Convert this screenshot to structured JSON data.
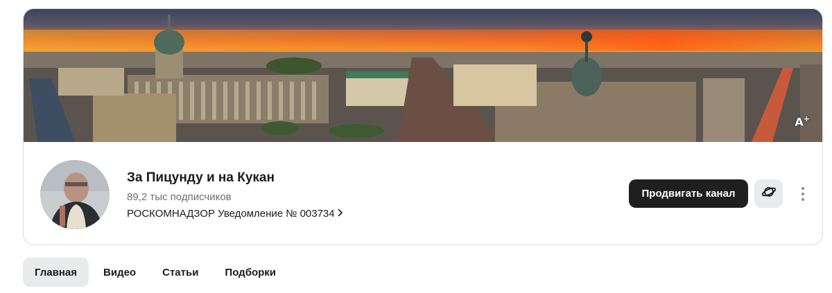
{
  "channel": {
    "name": "За Пицунду и на Кукан",
    "subscribers": "89,2 тыс подписчиков",
    "notice": "РОСКОМНАДЗОР Уведомление № 003734"
  },
  "banner": {
    "font_size_label": "A",
    "font_size_sup": "+"
  },
  "actions": {
    "promote_label": "Продвигать канал",
    "planet_icon": "planet-icon",
    "more_icon": "more-vertical-icon"
  },
  "tabs": [
    {
      "label": "Главная",
      "active": true
    },
    {
      "label": "Видео",
      "active": false
    },
    {
      "label": "Статьи",
      "active": false
    },
    {
      "label": "Подборки",
      "active": false
    }
  ],
  "colors": {
    "button_dark": "#1f1f1f",
    "tab_active_bg": "#e9eaec",
    "muted_text": "#6f6f6f"
  }
}
